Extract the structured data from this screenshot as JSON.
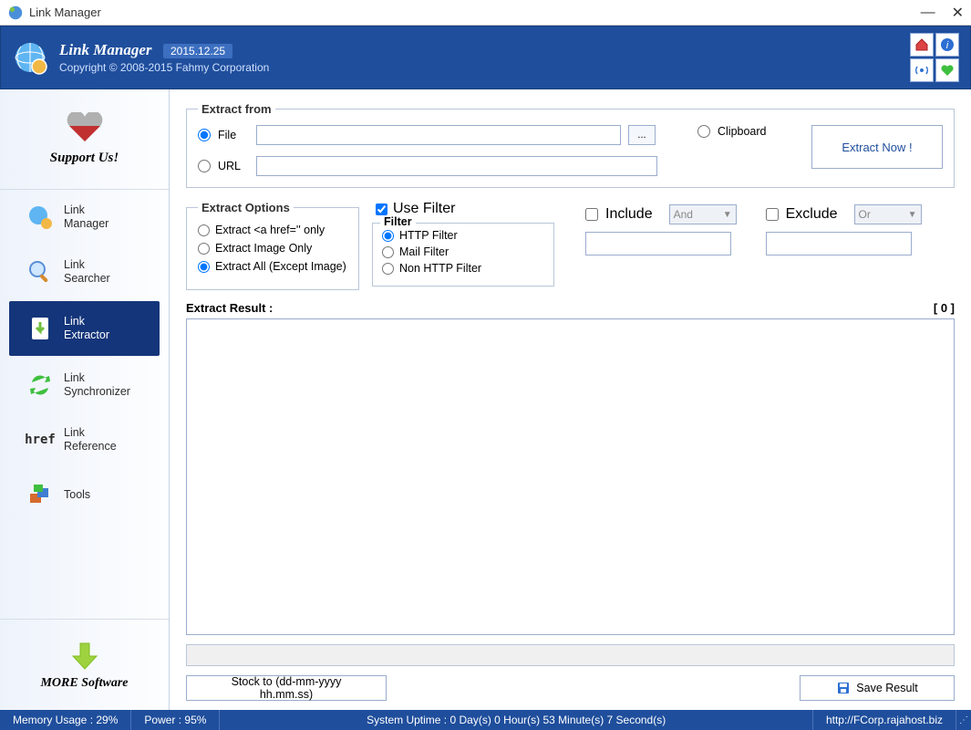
{
  "window": {
    "title": "Link Manager"
  },
  "header": {
    "title": "Link Manager",
    "version": "2015.12.25",
    "copyright": "Copyright © 2008-2015 Fahmy Corporation"
  },
  "sidebar": {
    "support": "Support Us!",
    "items": [
      {
        "line1": "Link",
        "line2": "Manager"
      },
      {
        "line1": "Link",
        "line2": "Searcher"
      },
      {
        "line1": "Link",
        "line2": "Extractor"
      },
      {
        "line1": "Link",
        "line2": "Synchronizer"
      },
      {
        "line1": "Link",
        "line2": "Reference"
      },
      {
        "line1": "Tools",
        "line2": ""
      }
    ],
    "more": "MORE Software"
  },
  "extract_from": {
    "legend": "Extract from",
    "file_label": "File",
    "url_label": "URL",
    "clipboard_label": "Clipboard",
    "browse_label": "...",
    "extract_now": "Extract Now !",
    "file_value": "",
    "url_value": ""
  },
  "extract_options": {
    "legend": "Extract Options",
    "opts": [
      "Extract <a href='' only",
      "Extract Image Only",
      "Extract All (Except Image)"
    ],
    "selected": 2
  },
  "filter": {
    "use_filter": "Use Filter",
    "legend": "Filter",
    "opts": [
      "HTTP Filter",
      "Mail Filter",
      "Non HTTP Filter"
    ],
    "selected": 0
  },
  "include": {
    "label": "Include",
    "combo": "And",
    "value": ""
  },
  "exclude": {
    "label": "Exclude",
    "combo": "Or",
    "value": ""
  },
  "result": {
    "label": "Extract Result :",
    "count": "[ 0 ]"
  },
  "buttons": {
    "stock": "Stock to (dd-mm-yyyy hh.mm.ss)",
    "save": "Save Result"
  },
  "statusbar": {
    "memory": "Memory Usage : 29%",
    "power": "Power : 95%",
    "uptime": "System Uptime : 0 Day(s) 0 Hour(s) 53 Minute(s) 7 Second(s)",
    "url": "http://FCorp.rajahost.biz"
  }
}
